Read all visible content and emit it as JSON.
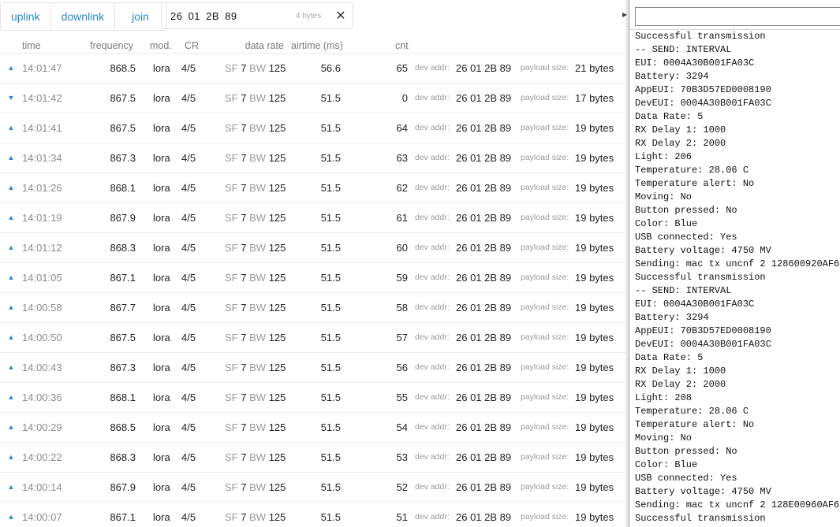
{
  "tabs": {
    "uplink": "uplink",
    "downlink": "downlink",
    "join": "join"
  },
  "filter": {
    "value": "26 01 2B 89",
    "bytes": "4 bytes",
    "clear": "✕"
  },
  "columns": {
    "time": "time",
    "frequency": "frequency",
    "mod": "mod.",
    "cr": "CR",
    "data_rate": "data rate",
    "airtime": "airtime (ms)",
    "cnt": "cnt"
  },
  "row_labels": {
    "sf": "SF",
    "bw": "BW",
    "dev_addr": "dev addr:",
    "payload_size": "payload size:"
  },
  "colors": {
    "accent": "#2b87c4",
    "muted": "#9a9a9a"
  },
  "rows": [
    {
      "dir": "up",
      "time": "14:01:47",
      "freq": "868.5",
      "mod": "lora",
      "cr": "4/5",
      "sf": "7",
      "bw": "125",
      "airtime": "56.6",
      "cnt": "65",
      "addr": "26 01 2B 89",
      "size": "21 bytes"
    },
    {
      "dir": "down",
      "time": "14:01:42",
      "freq": "867.5",
      "mod": "lora",
      "cr": "4/5",
      "sf": "7",
      "bw": "125",
      "airtime": "51.5",
      "cnt": "0",
      "addr": "26 01 2B 89",
      "size": "17 bytes"
    },
    {
      "dir": "up",
      "time": "14:01:41",
      "freq": "867.5",
      "mod": "lora",
      "cr": "4/5",
      "sf": "7",
      "bw": "125",
      "airtime": "51.5",
      "cnt": "64",
      "addr": "26 01 2B 89",
      "size": "19 bytes"
    },
    {
      "dir": "up",
      "time": "14:01:34",
      "freq": "867.3",
      "mod": "lora",
      "cr": "4/5",
      "sf": "7",
      "bw": "125",
      "airtime": "51.5",
      "cnt": "63",
      "addr": "26 01 2B 89",
      "size": "19 bytes"
    },
    {
      "dir": "up",
      "time": "14:01:26",
      "freq": "868.1",
      "mod": "lora",
      "cr": "4/5",
      "sf": "7",
      "bw": "125",
      "airtime": "51.5",
      "cnt": "62",
      "addr": "26 01 2B 89",
      "size": "19 bytes"
    },
    {
      "dir": "up",
      "time": "14:01:19",
      "freq": "867.9",
      "mod": "lora",
      "cr": "4/5",
      "sf": "7",
      "bw": "125",
      "airtime": "51.5",
      "cnt": "61",
      "addr": "26 01 2B 89",
      "size": "19 bytes"
    },
    {
      "dir": "up",
      "time": "14:01:12",
      "freq": "868.3",
      "mod": "lora",
      "cr": "4/5",
      "sf": "7",
      "bw": "125",
      "airtime": "51.5",
      "cnt": "60",
      "addr": "26 01 2B 89",
      "size": "19 bytes"
    },
    {
      "dir": "up",
      "time": "14:01:05",
      "freq": "867.1",
      "mod": "lora",
      "cr": "4/5",
      "sf": "7",
      "bw": "125",
      "airtime": "51.5",
      "cnt": "59",
      "addr": "26 01 2B 89",
      "size": "19 bytes"
    },
    {
      "dir": "up",
      "time": "14:00:58",
      "freq": "867.7",
      "mod": "lora",
      "cr": "4/5",
      "sf": "7",
      "bw": "125",
      "airtime": "51.5",
      "cnt": "58",
      "addr": "26 01 2B 89",
      "size": "19 bytes"
    },
    {
      "dir": "up",
      "time": "14:00:50",
      "freq": "867.5",
      "mod": "lora",
      "cr": "4/5",
      "sf": "7",
      "bw": "125",
      "airtime": "51.5",
      "cnt": "57",
      "addr": "26 01 2B 89",
      "size": "19 bytes"
    },
    {
      "dir": "up",
      "time": "14:00:43",
      "freq": "867.3",
      "mod": "lora",
      "cr": "4/5",
      "sf": "7",
      "bw": "125",
      "airtime": "51.5",
      "cnt": "56",
      "addr": "26 01 2B 89",
      "size": "19 bytes"
    },
    {
      "dir": "up",
      "time": "14:00:36",
      "freq": "868.1",
      "mod": "lora",
      "cr": "4/5",
      "sf": "7",
      "bw": "125",
      "airtime": "51.5",
      "cnt": "55",
      "addr": "26 01 2B 89",
      "size": "19 bytes"
    },
    {
      "dir": "up",
      "time": "14:00:29",
      "freq": "868.5",
      "mod": "lora",
      "cr": "4/5",
      "sf": "7",
      "bw": "125",
      "airtime": "51.5",
      "cnt": "54",
      "addr": "26 01 2B 89",
      "size": "19 bytes"
    },
    {
      "dir": "up",
      "time": "14:00:22",
      "freq": "868.3",
      "mod": "lora",
      "cr": "4/5",
      "sf": "7",
      "bw": "125",
      "airtime": "51.5",
      "cnt": "53",
      "addr": "26 01 2B 89",
      "size": "19 bytes"
    },
    {
      "dir": "up",
      "time": "14:00:14",
      "freq": "867.9",
      "mod": "lora",
      "cr": "4/5",
      "sf": "7",
      "bw": "125",
      "airtime": "51.5",
      "cnt": "52",
      "addr": "26 01 2B 89",
      "size": "19 bytes"
    },
    {
      "dir": "up",
      "time": "14:00:07",
      "freq": "867.1",
      "mod": "lora",
      "cr": "4/5",
      "sf": "7",
      "bw": "125",
      "airtime": "51.5",
      "cnt": "51",
      "addr": "26 01 2B 89",
      "size": "19 bytes"
    }
  ],
  "serial": {
    "input_value": "",
    "lines": [
      "Successful transmission",
      "-- SEND: INTERVAL",
      "EUI: 0004A30B001FA03C",
      "Battery: 3294",
      "AppEUI: 70B3D57ED0008190",
      "DevEUI: 0004A30B001FA03C",
      "Data Rate: 5",
      "RX Delay 1: 1000",
      "RX Delay 2: 2000",
      "Light: 206",
      "Temperature: 28.06 C",
      "Temperature alert: No",
      "Moving: No",
      "Button pressed: No",
      "Color: Blue",
      "USB connected: Yes",
      "Battery voltage: 4750 MV",
      "Sending: mac tx uncnf 2 128600920AF6",
      "Successful transmission",
      "-- SEND: INTERVAL",
      "EUI: 0004A30B001FA03C",
      "Battery: 3294",
      "AppEUI: 70B3D57ED0008190",
      "DevEUI: 0004A30B001FA03C",
      "Data Rate: 5",
      "RX Delay 1: 1000",
      "RX Delay 2: 2000",
      "Light: 208",
      "Temperature: 28.06 C",
      "Temperature alert: No",
      "Moving: No",
      "Button pressed: No",
      "Color: Blue",
      "USB connected: Yes",
      "Battery voltage: 4750 MV",
      "Sending: mac tx uncnf 2 128E00960AF6",
      "Successful transmission"
    ]
  }
}
